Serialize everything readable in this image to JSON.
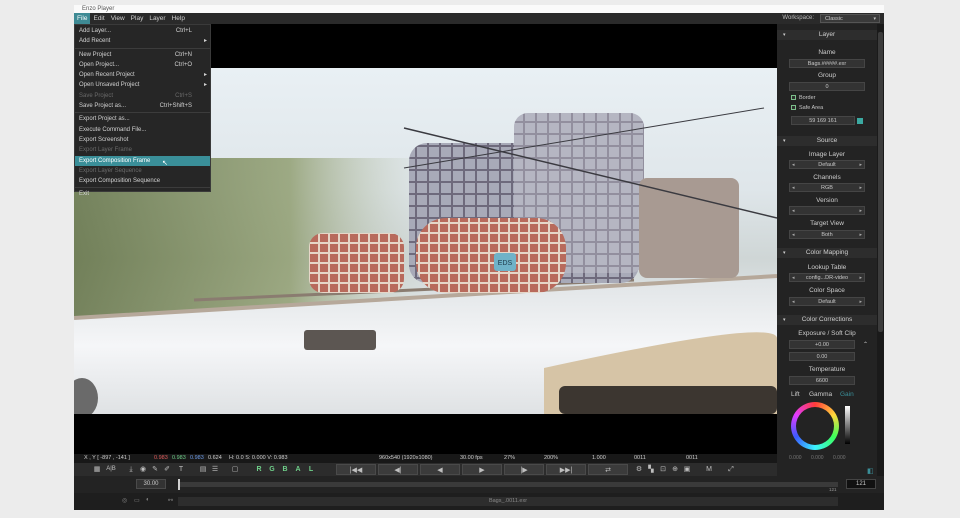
{
  "window": {
    "title": "Enzo Player"
  },
  "menubar": {
    "items": [
      "File",
      "Edit",
      "View",
      "Play",
      "Layer",
      "Help"
    ]
  },
  "workspace": {
    "label": "Workspace:",
    "value": "Classic"
  },
  "file_menu": {
    "items": [
      {
        "label": "Add Layer...",
        "shortcut": "Ctrl+L",
        "state": "normal"
      },
      {
        "label": "Add Recent",
        "shortcut": "",
        "state": "submenu"
      },
      {
        "label": "New Project",
        "shortcut": "Ctrl+N",
        "state": "normal"
      },
      {
        "label": "Open Project...",
        "shortcut": "Ctrl+O",
        "state": "normal"
      },
      {
        "label": "Open Recent Project",
        "shortcut": "",
        "state": "submenu"
      },
      {
        "label": "Open Unsaved Project",
        "shortcut": "",
        "state": "submenu"
      },
      {
        "label": "Save Project",
        "shortcut": "Ctrl+S",
        "state": "disabled"
      },
      {
        "label": "Save Project as...",
        "shortcut": "Ctrl+Shift+S",
        "state": "normal"
      },
      {
        "label": "Export Project as...",
        "shortcut": "",
        "state": "normal"
      },
      {
        "label": "Execute Command File...",
        "shortcut": "",
        "state": "normal"
      },
      {
        "label": "Export Screenshot",
        "shortcut": "",
        "state": "normal"
      },
      {
        "label": "Export Layer Frame",
        "shortcut": "",
        "state": "disabled"
      },
      {
        "label": "Export Composition Frame",
        "shortcut": "",
        "state": "highlighted"
      },
      {
        "label": "Export Layer Sequence",
        "shortcut": "",
        "state": "disabled"
      },
      {
        "label": "Export Composition Sequence",
        "shortcut": "",
        "state": "normal"
      },
      {
        "label": "Exit",
        "shortcut": "",
        "state": "normal"
      }
    ]
  },
  "image": {
    "tag_text": "EDS"
  },
  "status": {
    "coords": "X , Y [ -897 , -141 ]",
    "r": "0.983",
    "g": "0.983",
    "b": "0.983",
    "a": "0.624",
    "hsv": "H: 0.0  S: 0.000  V: 0.983",
    "resolution": "960x540 (1920x1080)",
    "fps": "30.00 fps",
    "zoom_a": "27%",
    "zoom_b": "200%",
    "ratio": "1.000",
    "frame_a": "0011",
    "frame_b": "0011"
  },
  "toolbar": {
    "ab_label": "A|B",
    "channels": [
      "R",
      "G",
      "B",
      "A",
      "L"
    ],
    "text_tool": "T",
    "mode": "M"
  },
  "timeline": {
    "fps_value": "30.00",
    "end_frame": "121",
    "tick_end": "121"
  },
  "bottom": {
    "layer_name": "Bags_.0011.exr"
  },
  "panel": {
    "layer_header": "Layer",
    "name_label": "Name",
    "name_value": "Bags.#####.exr",
    "group_label": "Group",
    "group_value": "0",
    "border_label": "Border",
    "safe_area_label": "Safe Area",
    "color_value": "59 169 161",
    "source_header": "Source",
    "image_layer_label": "Image Layer",
    "image_layer_value": "Default",
    "channels_label": "Channels",
    "channels_value": "RGB",
    "version_label": "Version",
    "version_value": "",
    "target_view_label": "Target View",
    "target_view_value": "Both",
    "color_mapping_header": "Color Mapping",
    "lookup_label": "Lookup Table",
    "lookup_value": "config...DR-video",
    "colorspace_label": "Color Space",
    "colorspace_value": "Default",
    "color_corrections_header": "Color Corrections",
    "exposure_label": "Exposure / Soft Clip",
    "exposure_value": "+0.00",
    "softclip_value": "0.00",
    "temperature_label": "Temperature",
    "temperature_value": "6600",
    "lift_label": "Lift",
    "gamma_label": "Gamma",
    "gain_label": "Gain",
    "wheel_values": [
      "0.000",
      "0.000",
      "0.000"
    ]
  },
  "colors": {
    "accent": "#3a8f99",
    "layer_color": "#3ba9a1"
  }
}
